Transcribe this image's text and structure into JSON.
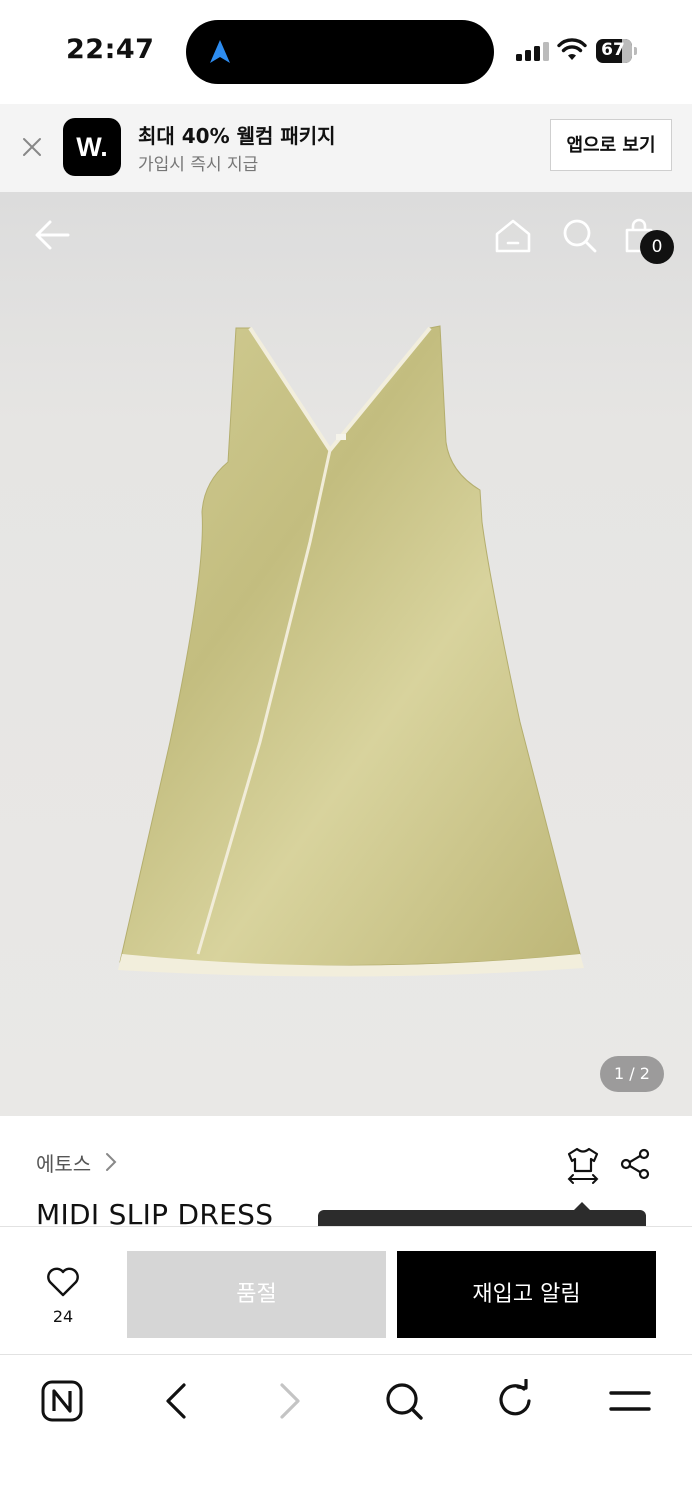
{
  "status_bar": {
    "time": "22:47",
    "battery": "67"
  },
  "app_banner": {
    "logo": "W.",
    "title": "최대 40% 웰컴 패키지",
    "subtitle": "가입시 즉시 지급",
    "open_app_label": "앱으로 보기"
  },
  "top_nav": {
    "cart_count": "0"
  },
  "gallery": {
    "page_indicator": "1 / 2"
  },
  "product": {
    "brand": "에토스",
    "title": "MIDI SLIP DRESS"
  },
  "action_bar": {
    "like_count": "24",
    "sold_out_label": "품절",
    "restock_label": "재입고 알림"
  },
  "colors": {
    "accent_dark": "#000000",
    "sold_out_gray": "#d6d6d6",
    "dress": "#c9c48a"
  }
}
